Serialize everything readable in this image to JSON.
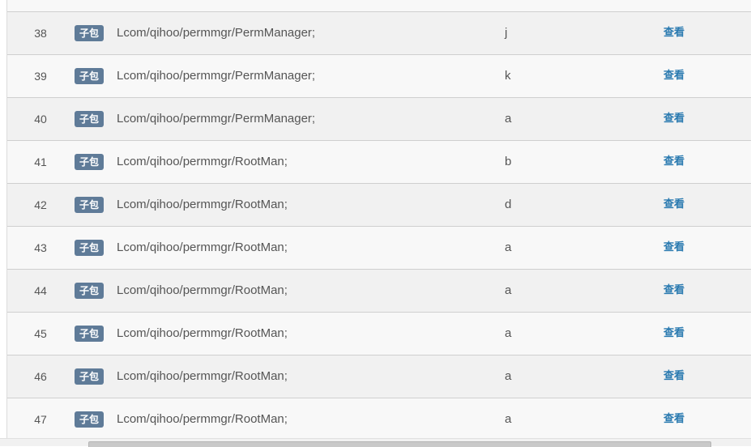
{
  "table": {
    "rows": [
      {
        "index": "38",
        "tag": "子包",
        "class_path": "Lcom/qihoo/permmgr/PermManager;",
        "method": "j",
        "action": "查看"
      },
      {
        "index": "39",
        "tag": "子包",
        "class_path": "Lcom/qihoo/permmgr/PermManager;",
        "method": "k",
        "action": "查看"
      },
      {
        "index": "40",
        "tag": "子包",
        "class_path": "Lcom/qihoo/permmgr/PermManager;",
        "method": "a",
        "action": "查看"
      },
      {
        "index": "41",
        "tag": "子包",
        "class_path": "Lcom/qihoo/permmgr/RootMan;",
        "method": "b",
        "action": "查看"
      },
      {
        "index": "42",
        "tag": "子包",
        "class_path": "Lcom/qihoo/permmgr/RootMan;",
        "method": "d",
        "action": "查看"
      },
      {
        "index": "43",
        "tag": "子包",
        "class_path": "Lcom/qihoo/permmgr/RootMan;",
        "method": "a",
        "action": "查看"
      },
      {
        "index": "44",
        "tag": "子包",
        "class_path": "Lcom/qihoo/permmgr/RootMan;",
        "method": "a",
        "action": "查看"
      },
      {
        "index": "45",
        "tag": "子包",
        "class_path": "Lcom/qihoo/permmgr/RootMan;",
        "method": "a",
        "action": "查看"
      },
      {
        "index": "46",
        "tag": "子包",
        "class_path": "Lcom/qihoo/permmgr/RootMan;",
        "method": "a",
        "action": "查看"
      },
      {
        "index": "47",
        "tag": "子包",
        "class_path": "Lcom/qihoo/permmgr/RootMan;",
        "method": "a",
        "action": "查看"
      }
    ]
  },
  "colors": {
    "badge_bg": "#5f7b98",
    "link": "#2a7ab0",
    "row_odd": "#f1f1f1",
    "row_even": "#f8f8f8"
  }
}
